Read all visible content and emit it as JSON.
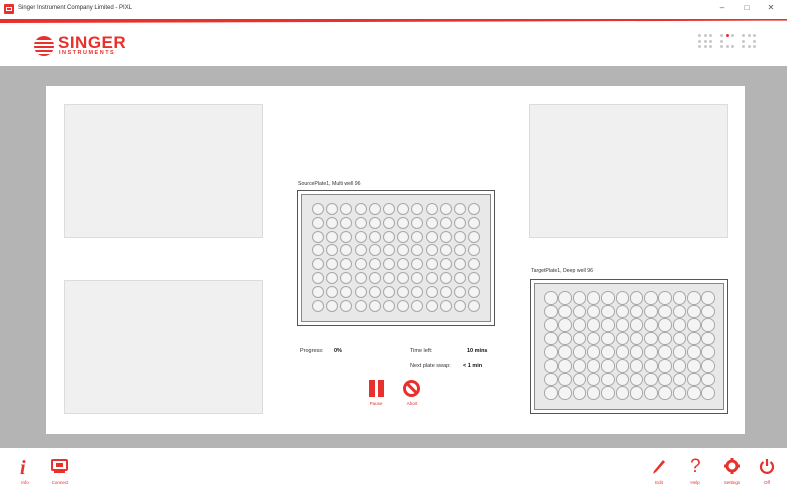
{
  "window": {
    "title": "Singer Instrument Company Limited - PIXL",
    "minimize_glyph": "–",
    "maximize_glyph": "□",
    "close_glyph": "✕"
  },
  "brand": {
    "name": "SINGER",
    "subname": "INSTRUMENTS",
    "accent_color": "#e8302c"
  },
  "plates": {
    "source": {
      "label": "SourcePlate1, Multi well 96",
      "rows": 8,
      "cols": 12
    },
    "target": {
      "label": "TargetPlate1, Deep well 96",
      "rows": 8,
      "cols": 12
    }
  },
  "status": {
    "progress_label": "Progress:",
    "progress_value": "0%",
    "time_left_label": "Time left:",
    "time_left_value": "10 mins",
    "next_swap_label": "Next plate swap:",
    "next_swap_value": "< 1 min"
  },
  "controls": {
    "pause_label": "Pause",
    "abort_label": "Abort"
  },
  "footer": {
    "info_label": "Info",
    "connect_label": "Connect",
    "edit_label": "Edit",
    "help_label": "Help",
    "settings_label": "Settings",
    "off_label": "Off"
  },
  "icons": [
    "app-icon",
    "singer-logo-icon",
    "pixl-dot-logo-icon",
    "pause-icon",
    "abort-icon",
    "info-icon",
    "connect-icon",
    "edit-icon",
    "help-icon",
    "settings-icon",
    "power-icon"
  ]
}
